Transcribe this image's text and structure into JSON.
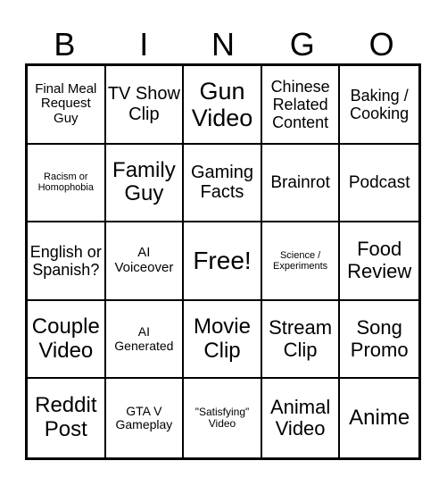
{
  "title_letters": [
    "B",
    "I",
    "N",
    "G",
    "O"
  ],
  "cells": [
    {
      "text": "Final Meal Request Guy"
    },
    {
      "text": "TV Show Clip"
    },
    {
      "text": "Gun Video"
    },
    {
      "text": "Chinese Related Content"
    },
    {
      "text": "Baking / Cooking"
    },
    {
      "text": "Racism or Homophobia"
    },
    {
      "text": "Family Guy"
    },
    {
      "text": "Gaming Facts"
    },
    {
      "text": "Brainrot"
    },
    {
      "text": "Podcast"
    },
    {
      "text": "English or Spanish?"
    },
    {
      "text": "AI Voiceover"
    },
    {
      "text": "Free!"
    },
    {
      "text": "Science / Experiments"
    },
    {
      "text": "Food Review"
    },
    {
      "text": "Couple Video"
    },
    {
      "text": "AI Generated"
    },
    {
      "text": "Movie Clip"
    },
    {
      "text": "Stream Clip"
    },
    {
      "text": "Song Promo"
    },
    {
      "text": "Reddit Post"
    },
    {
      "text": "GTA V Gameplay"
    },
    {
      "text": "\"Satisfying\" Video"
    },
    {
      "text": "Animal Video"
    },
    {
      "text": "Anime"
    }
  ]
}
